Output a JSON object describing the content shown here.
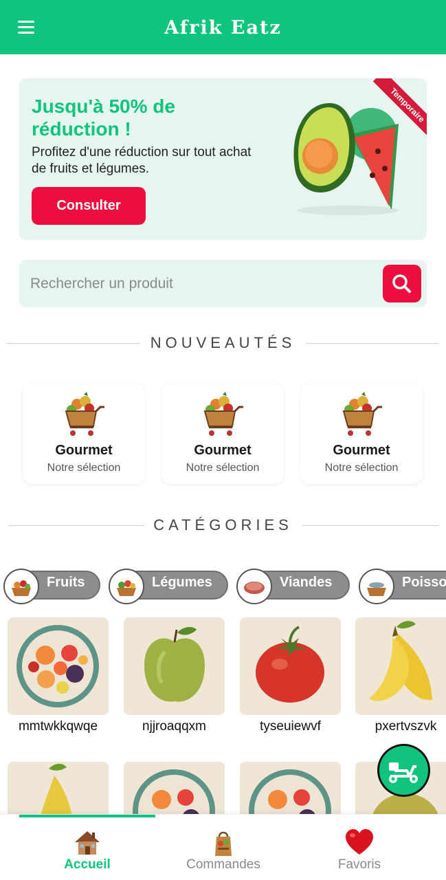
{
  "app": {
    "title": "Afrik Eatz"
  },
  "promo": {
    "title": "Jusqu'à 50% de réduction !",
    "text": "Profitez d'une réduction sur tout achat de fruits et légumes.",
    "button_label": "Consulter",
    "ribbon_label": "Temporaire"
  },
  "search": {
    "placeholder": "Rechercher un produit"
  },
  "sections": {
    "new": "NOUVEAUTÉS",
    "categories": "CATÉGORIES"
  },
  "new_items": [
    {
      "title": "Gourmet",
      "subtitle": "Notre sélection"
    },
    {
      "title": "Gourmet",
      "subtitle": "Notre sélection"
    },
    {
      "title": "Gourmet",
      "subtitle": "Notre sélection"
    }
  ],
  "categories": [
    {
      "label": "Fruits"
    },
    {
      "label": "Légumes"
    },
    {
      "label": "Viandes"
    },
    {
      "label": "Poisso"
    }
  ],
  "products_row1": [
    {
      "name": "mmtwkkqwqe",
      "image": "fruit-plate"
    },
    {
      "name": "njjroaqqxm",
      "image": "apple"
    },
    {
      "name": "tyseuiewvf",
      "image": "tomato"
    },
    {
      "name": "pxertvszvk",
      "image": "banana"
    }
  ],
  "products_row2": [
    {
      "image": "banana"
    },
    {
      "image": "fruit-plate"
    },
    {
      "image": "fruit-plate"
    },
    {
      "image": "fruit"
    }
  ],
  "nav": {
    "items": [
      {
        "label": "Accueil",
        "icon": "house-icon",
        "active": true
      },
      {
        "label": "Commandes",
        "icon": "shopping-bag-icon",
        "active": false
      },
      {
        "label": "Favoris",
        "icon": "heart-icon",
        "active": false
      }
    ]
  },
  "colors": {
    "primary": "#0fc47d",
    "accent": "#ec0f3e",
    "soft": "#e6f5ef"
  }
}
